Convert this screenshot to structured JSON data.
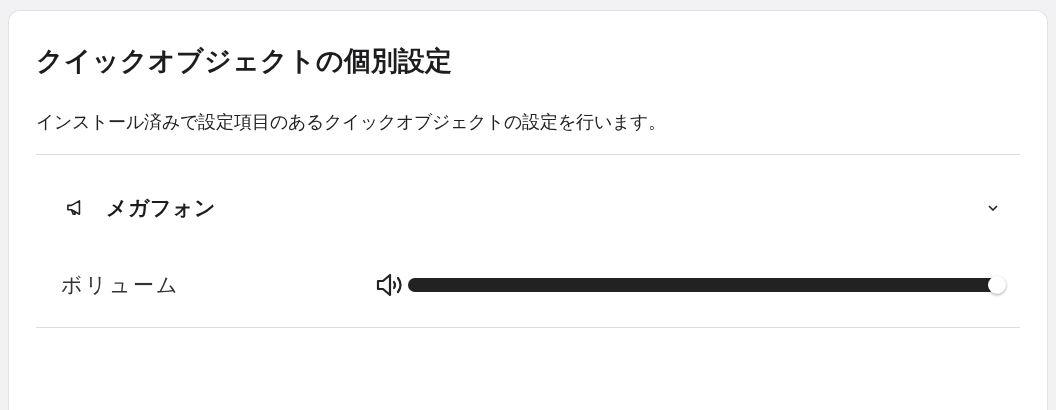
{
  "card": {
    "title": "クイックオブジェクトの個別設定",
    "description": "インストール済みで設定項目のあるクイックオブジェクトの設定を行います。"
  },
  "sections": [
    {
      "name": "メガフォン",
      "expanded": true,
      "settings": [
        {
          "label": "ボリューム",
          "level": 1.0
        }
      ]
    }
  ]
}
